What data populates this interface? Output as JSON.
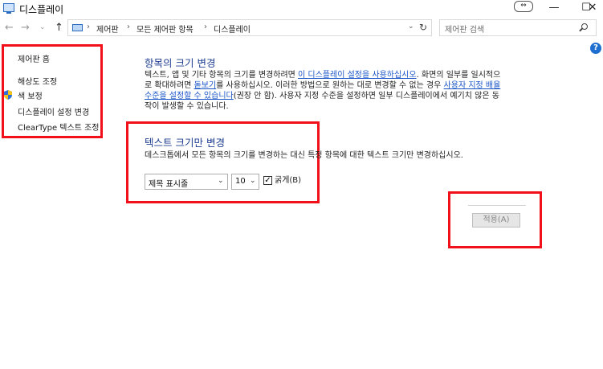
{
  "window": {
    "title": "디스플레이",
    "restore_glyph": "⇔",
    "minimize_glyph": "—",
    "maximize_glyph": "☐",
    "close_glyph": "✕"
  },
  "nav": {
    "back": "←",
    "forward": "→",
    "dropdown": "⌄",
    "up": "↑"
  },
  "address": {
    "crumbs": [
      "제어판",
      "모든 제어판 항목",
      "디스플레이"
    ],
    "separator": "›",
    "dropdown_glyph": "⌄",
    "refresh_glyph": "↻"
  },
  "search": {
    "placeholder": "제어판 검색"
  },
  "help": "?",
  "sidebar": {
    "items": [
      "제어판 홈",
      "해상도 조정",
      "색 보정",
      "디스플레이 설정 변경",
      "ClearType 텍스트 조정"
    ]
  },
  "main": {
    "resize_heading": "항목의 크기 변경",
    "resize_p1_a": "텍스트, 앱 및 기타 항목의 크기를 변경하려면 ",
    "resize_p1_link": "이 디스플레이 설정을 사용하십시오",
    "resize_p1_b": ". 화면의 일부를 일시적으",
    "resize_p2_a": "로 확대하려면 ",
    "resize_p2_link": "돋보기",
    "resize_p2_b": "를 사용하십시오. 이러한 방법으로 원하는 대로 변경할 수 없는 경우 ",
    "resize_p2_link2": "사용자 지정 배율",
    "resize_p3_link": "수준을 설정할 수 있습니다",
    "resize_p3_b": "(권장 안 함). 사용자 지정 수준을 설정하면 일부 디스플레이에서 예기치 않은 동",
    "resize_p4": "작이 발생할 수 있습니다.",
    "text_heading": "텍스트 크기만 변경",
    "text_desc": "데스크톱에서 모든 항목의 크기를 변경하는 대신 특정 항목에 대한 텍스트 크기만 변경하십시오.",
    "item_select": "제목 표시줄",
    "size_select": "10",
    "bold_label": "굵게(B)",
    "bold_checked": "✓",
    "apply_label": "적용(A)"
  },
  "colors": {
    "heading": "#1e3d91",
    "link": "#1a55c8",
    "highlight": "#f2101a"
  }
}
